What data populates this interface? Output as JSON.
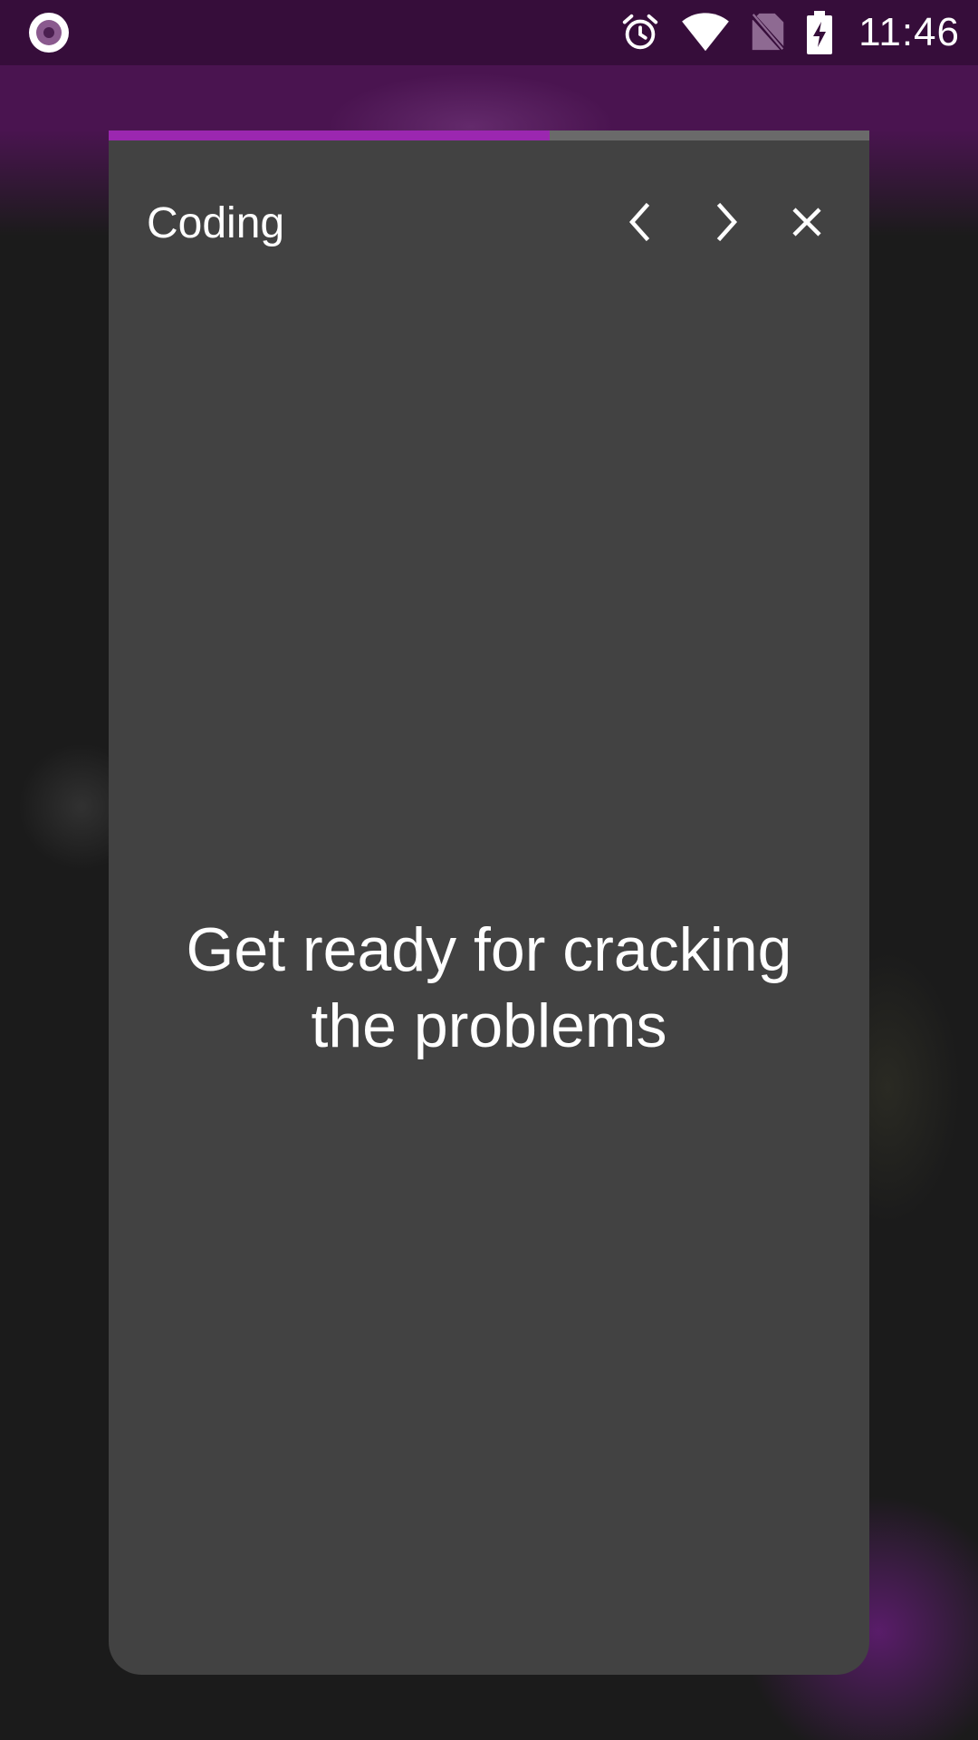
{
  "status_bar": {
    "time": "11:46",
    "icons": [
      "app-notification-icon",
      "alarm-icon",
      "wifi-icon",
      "no-sim-icon",
      "battery-charging-icon"
    ]
  },
  "story": {
    "title": "Coding",
    "message": "Get ready for cracking the problems",
    "progress_fraction": 0.58,
    "controls": {
      "previous_icon": "chevron-left-icon",
      "next_icon": "chevron-right-icon",
      "close_icon": "close-icon"
    }
  },
  "colors": {
    "accent": "#9b27b0",
    "card_background": "#424242",
    "status_bar": "#360d3a",
    "header_background": "#4a1450",
    "progress_track": "#6a6a6a"
  }
}
